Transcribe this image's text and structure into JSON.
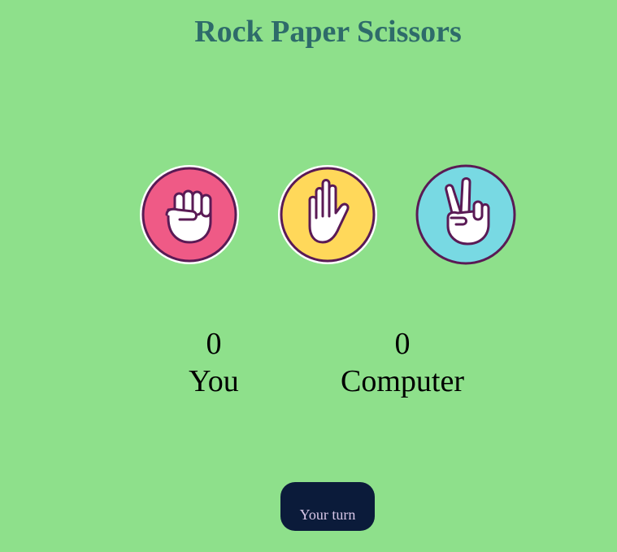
{
  "title": "Rock Paper Scissors",
  "choices": [
    {
      "id": "rock",
      "icon": "fist-icon",
      "color": "#ef5a86"
    },
    {
      "id": "paper",
      "icon": "open-hand-icon",
      "color": "#ffd85a"
    },
    {
      "id": "scissors",
      "icon": "peace-hand-icon",
      "color": "#78d9e3"
    }
  ],
  "scores": {
    "you": {
      "value": "0",
      "label": "You"
    },
    "computer": {
      "value": "0",
      "label": "Computer"
    }
  },
  "turn_button": {
    "label": "Your turn"
  },
  "colors": {
    "background": "#8ee08b",
    "title": "#2e6b6a",
    "outline": "#5a1a55",
    "button": "#0b1b3a"
  }
}
